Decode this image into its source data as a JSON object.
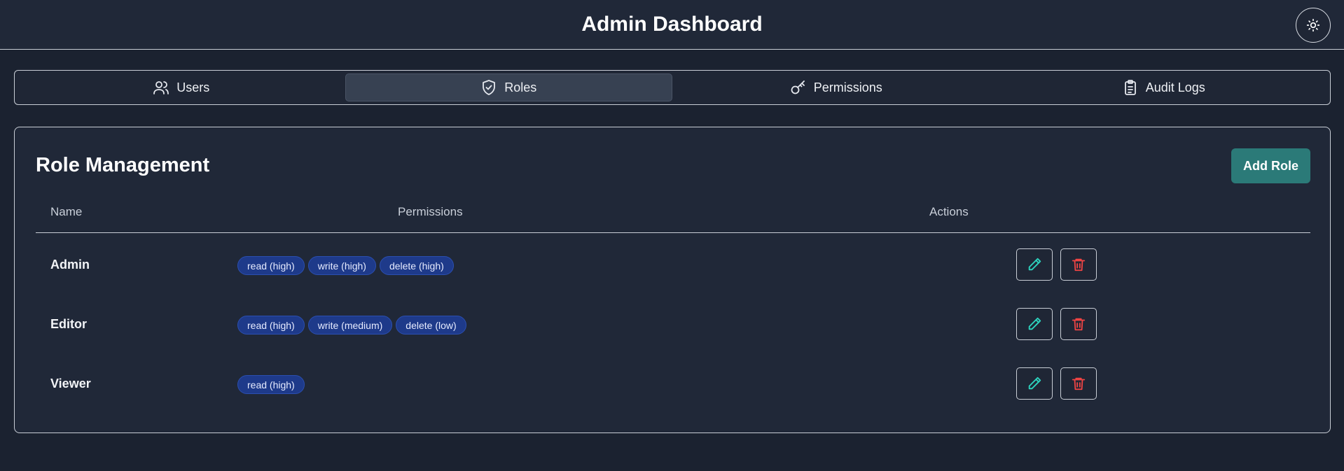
{
  "header": {
    "title": "Admin Dashboard",
    "theme_toggle_icon": "sun-icon"
  },
  "tabs": [
    {
      "label": "Users",
      "icon": "users-icon",
      "active": false
    },
    {
      "label": "Roles",
      "icon": "shield-icon",
      "active": true
    },
    {
      "label": "Permissions",
      "icon": "key-icon",
      "active": false
    },
    {
      "label": "Audit Logs",
      "icon": "clipboard-icon",
      "active": false
    }
  ],
  "card": {
    "title": "Role Management",
    "add_button_label": "Add Role",
    "columns": [
      "Name",
      "Permissions",
      "Actions"
    ],
    "rows": [
      {
        "name": "Admin",
        "permissions": [
          "read (high)",
          "write (high)",
          "delete (high)"
        ]
      },
      {
        "name": "Editor",
        "permissions": [
          "read (high)",
          "write (medium)",
          "delete (low)"
        ]
      },
      {
        "name": "Viewer",
        "permissions": [
          "read (high)"
        ]
      }
    ]
  },
  "colors": {
    "background": "#1b2230",
    "accent": "#2b7a78",
    "badge": "#1e3a8a",
    "edit_icon": "#2dd4bf",
    "delete_icon": "#ef4444"
  }
}
